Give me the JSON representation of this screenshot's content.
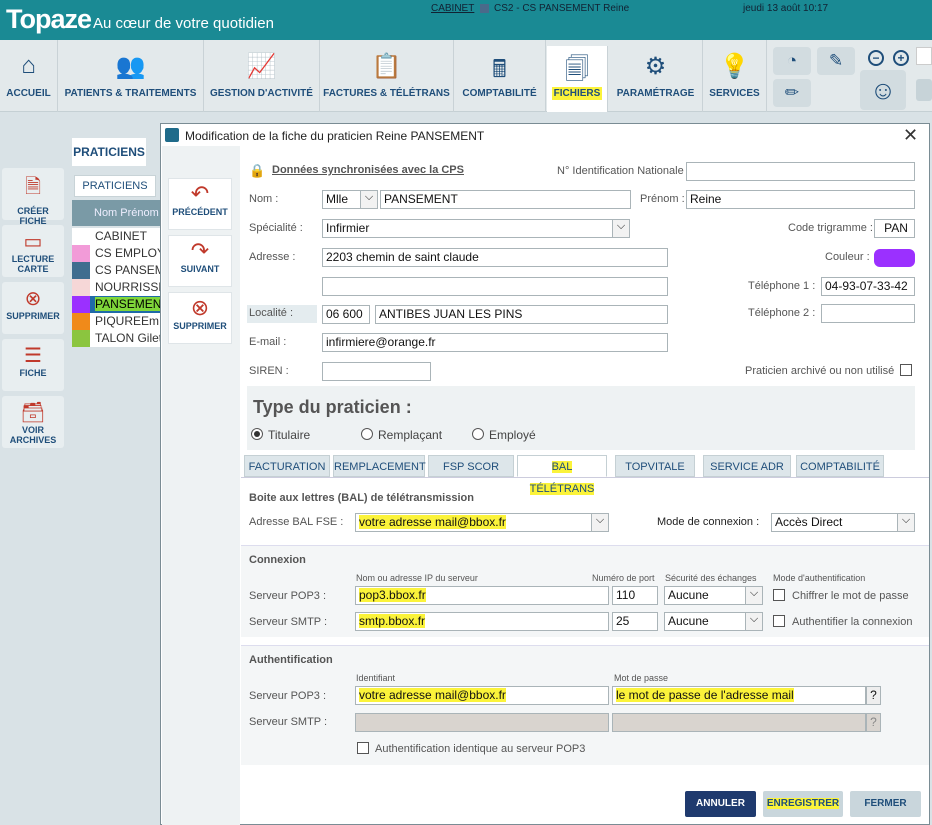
{
  "app": {
    "logo": "Topaze",
    "tagline": "Au cœur de votre quotidien",
    "cabinet_link": "CABINET",
    "cabinet_user": "CS2 - CS PANSEMENT Reine",
    "date": "jeudi 13 août 10:17"
  },
  "toolbar": {
    "items": [
      {
        "label": "ACCUEIL"
      },
      {
        "label": "PATIENTS & TRAITEMENTS"
      },
      {
        "label": "GESTION D'ACTIVITÉ"
      },
      {
        "label": "FACTURES & TÉLÉTRANS"
      },
      {
        "label": "COMPTABILITÉ"
      },
      {
        "label": "FICHIERS"
      },
      {
        "label": "PARAMÉTRAGE"
      },
      {
        "label": "SERVICES"
      }
    ]
  },
  "sidebar": {
    "items": [
      {
        "l1": "CRÉER",
        "l2": "FICHE"
      },
      {
        "l1": "LECTURE",
        "l2": "CARTE"
      },
      {
        "l1": "SUPPRIMER",
        "l2": ""
      },
      {
        "l1": "FICHE",
        "l2": ""
      },
      {
        "l1": "VOIR",
        "l2": "ARCHIVES"
      }
    ]
  },
  "left": {
    "tab": "PRATICIENS",
    "inner_tab": "PRATICIENS",
    "col": "Nom Prénom",
    "rows": [
      "CABINET",
      "CS EMPLOYE",
      "CS PANSEMENT",
      "NOURRISSE",
      "PANSEMENT",
      "PIQUREEm",
      "TALON Gilet"
    ]
  },
  "dialog": {
    "title": "Modification de la fiche du praticien Reine PANSEMENT",
    "close": "✕",
    "nav": {
      "prev": "PRÉCÉDENT",
      "next": "SUIVANT",
      "delete": "SUPPRIMER"
    },
    "sync": "Données synchronisées avec la CPS",
    "nin_label": "N° Identification Nationale :",
    "nin": "",
    "nom_label": "Nom :",
    "civ": "Mlle",
    "nom": "PANSEMENT",
    "prenom_label": "Prénom :",
    "prenom": "Reine",
    "spec_label": "Spécialité :",
    "spec": "Infirmier",
    "trig_label": "Code trigramme :",
    "trig": "PAN",
    "adr_label": "Adresse :",
    "adr1": "2203 chemin de saint claude",
    "adr2": "",
    "color_label": "Couleur :",
    "color": "#9b30ff",
    "tel1_label": "Téléphone 1 :",
    "tel1": "04-93-07-33-42",
    "tel2_label": "Téléphone 2 :",
    "tel2": "",
    "loc_label": "Localité :",
    "cp": "06 600",
    "ville": "ANTIBES JUAN LES PINS",
    "email_label": "E-mail :",
    "email": "infirmiere@orange.fr",
    "siren_label": "SIREN :",
    "siren": "",
    "archive_label": "Praticien archivé ou non utilisé",
    "type_title": "Type du praticien :",
    "types": [
      "Titulaire",
      "Remplaçant",
      "Employé"
    ],
    "tabs": [
      "FACTURATION",
      "REMPLACEMENT",
      "FSP SCOR",
      "BAL TÉLÉTRANS",
      "TOPVITALE",
      "SERVICE ADR",
      "COMPTABILITÉ"
    ],
    "bal": {
      "heading": "Boite aux lettres (BAL) de télétransmission",
      "adr_label": "Adresse BAL FSE :",
      "adr": "votre adresse mail@bbox.fr",
      "mode_label": "Mode de connexion :",
      "mode": "Accès Direct"
    },
    "conn": {
      "heading": "Connexion",
      "col_server": "Nom ou adresse IP du serveur",
      "col_port": "Numéro de port",
      "col_sec": "Sécurité des échanges",
      "col_auth": "Mode d'authentification",
      "pop3_label": "Serveur POP3 :",
      "pop3": "pop3.bbox.fr",
      "pop3_port": "110",
      "pop3_sec": "Aucune",
      "pop3_auth": "Chiffrer le mot de passe",
      "smtp_label": "Serveur SMTP :",
      "smtp": "smtp.bbox.fr",
      "smtp_port": "25",
      "smtp_sec": "Aucune",
      "smtp_auth": "Authentifier la connexion"
    },
    "auth": {
      "heading": "Authentification",
      "col_id": "Identifiant",
      "col_pw": "Mot de passe",
      "pop3_label": "Serveur POP3 :",
      "pop3_id": "votre adresse mail@bbox.fr",
      "pop3_pw": "le mot de passe de l'adresse mail",
      "smtp_label": "Serveur SMTP :",
      "same": "Authentification identique au serveur POP3",
      "q": "?"
    },
    "buttons": {
      "cancel": "ANNULER",
      "save": "ENREGISTRER",
      "close": "FERMER"
    }
  }
}
